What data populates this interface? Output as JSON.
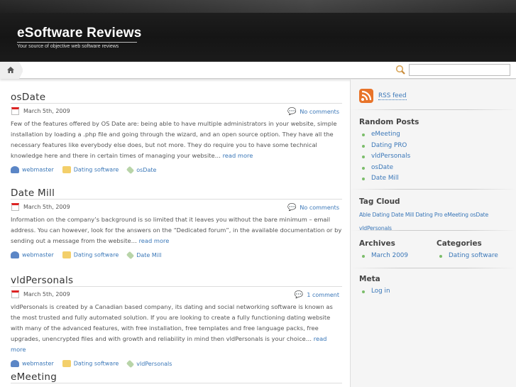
{
  "header": {
    "title": "eSoftware Reviews",
    "tagline": "Your source of objective web software reviews"
  },
  "nav": {
    "home_icon": "home-icon",
    "search_placeholder": ""
  },
  "posts": [
    {
      "title": "osDate",
      "date": "March 5th, 2009",
      "comments": "No comments",
      "body": "Few of the features offered by OS Date are: being able to have multiple administrators in your website, simple installation by loading a .php file and going through the wizard, and an open source option. They have all the necessary features like everybody else does, but not more. They do require you to have some technical knowledge here and there in certain times of managing your website…",
      "read_more": "read more",
      "author": "webmaster",
      "category": "Dating software",
      "tag": "osDate"
    },
    {
      "title": "Date Mill",
      "date": "March 5th, 2009",
      "comments": "No comments",
      "body": "Information on the company’s background is so limited that it leaves you without the bare minimum – email address. You can however, look for the answers on the “Dedicated forum”, in the available documentation or by sending out a message from the website…",
      "read_more": "read more",
      "author": "webmaster",
      "category": "Dating software",
      "tag": "Date Mill"
    },
    {
      "title": "vldPersonals",
      "date": "March 5th, 2009",
      "comments": "1 comment",
      "body": "vldPersonals is created by a Canadian based company, its dating and social networking software is known as the most trusted and fully automated solution. If you are looking to create a fully functioning dating website with many of the advanced features, with free installation, free templates and free language packs, free upgrades, unencrypted files and with growth and reliability in mind then vldPersonals is your choice…",
      "read_more": "read more",
      "author": "webmaster",
      "category": "Dating software",
      "tag": "vldPersonals"
    },
    {
      "title": "eMeeting"
    }
  ],
  "sidebar": {
    "rss": "RSS feed",
    "random_title": "Random Posts",
    "random": [
      "eMeeting",
      "Dating PRO",
      "vldPersonals",
      "osDate",
      "Date Mill"
    ],
    "tagcloud_title": "Tag Cloud",
    "tags": "Able Dating Date Mill Dating Pro eMeeting osDate vldPersonals",
    "archives_title": "Archives",
    "archives": [
      "March 2009"
    ],
    "categories_title": "Categories",
    "categories": [
      "Dating software"
    ],
    "meta_title": "Meta",
    "meta": [
      "Log in"
    ]
  }
}
